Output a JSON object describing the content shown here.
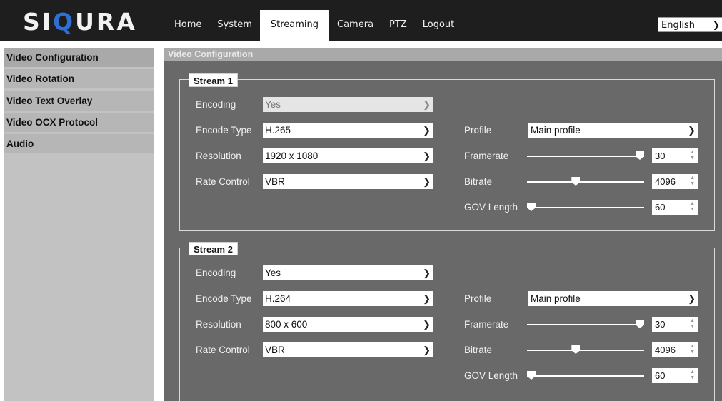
{
  "header": {
    "logo": {
      "before": "SI",
      "accent": "Q",
      "after": "URA"
    },
    "nav": [
      {
        "label": "Home"
      },
      {
        "label": "System"
      },
      {
        "label": "Streaming"
      },
      {
        "label": "Camera"
      },
      {
        "label": "PTZ"
      },
      {
        "label": "Logout"
      }
    ],
    "active_nav": "Streaming",
    "language": "English"
  },
  "sidebar": {
    "items": [
      {
        "label": "Video Configuration"
      },
      {
        "label": "Video Rotation"
      },
      {
        "label": "Video Text Overlay"
      },
      {
        "label": "Video OCX Protocol"
      },
      {
        "label": "Audio"
      }
    ]
  },
  "main": {
    "title": "Video Configuration",
    "streams": [
      {
        "legend": "Stream 1",
        "encoding_label": "Encoding",
        "encoding": "Yes",
        "encoding_disabled": true,
        "encode_type_label": "Encode Type",
        "encode_type": "H.265",
        "resolution_label": "Resolution",
        "resolution": "1920 x 1080",
        "rate_control_label": "Rate Control",
        "rate_control": "VBR",
        "profile_label": "Profile",
        "profile": "Main profile",
        "framerate_label": "Framerate",
        "framerate": "30",
        "framerate_pos": 1.0,
        "bitrate_label": "Bitrate",
        "bitrate": "4096",
        "bitrate_pos": 0.41,
        "gov_label": "GOV Length",
        "gov": "60",
        "gov_pos": 0.0
      },
      {
        "legend": "Stream 2",
        "encoding_label": "Encoding",
        "encoding": "Yes",
        "encoding_disabled": false,
        "encode_type_label": "Encode Type",
        "encode_type": "H.264",
        "resolution_label": "Resolution",
        "resolution": "800 x 600",
        "rate_control_label": "Rate Control",
        "rate_control": "VBR",
        "profile_label": "Profile",
        "profile": "Main profile",
        "framerate_label": "Framerate",
        "framerate": "30",
        "framerate_pos": 1.0,
        "bitrate_label": "Bitrate",
        "bitrate": "4096",
        "bitrate_pos": 0.41,
        "gov_label": "GOV Length",
        "gov": "60",
        "gov_pos": 0.0
      }
    ]
  },
  "icons": {
    "dropdown": "chevron-down-icon",
    "spinner": "spin-arrows-icon",
    "slider": "slider-thumb-icon"
  },
  "colors": {
    "topbar": "#1e1e1e",
    "logo_accent": "#2f6fd1",
    "panel": "#696969",
    "sidebar": "#c2c2c2"
  }
}
